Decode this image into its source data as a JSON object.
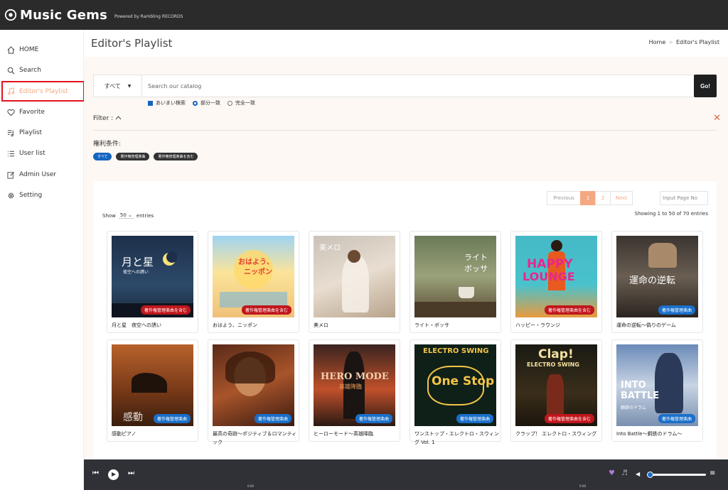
{
  "app": {
    "name": "Music Gems",
    "powered": "Powered by Rambling RECORDS"
  },
  "sidebar": {
    "items": [
      {
        "label": "HOME",
        "icon": "home-icon"
      },
      {
        "label": "Search",
        "icon": "search-icon"
      },
      {
        "label": "Editor's Playlist",
        "icon": "music-note-icon"
      },
      {
        "label": "Favorite",
        "icon": "heart-icon"
      },
      {
        "label": "Playlist",
        "icon": "playlist-icon"
      },
      {
        "label": "User list",
        "icon": "list-icon"
      },
      {
        "label": "Admin User",
        "icon": "edit-icon"
      },
      {
        "label": "Setting",
        "icon": "gear-icon"
      }
    ]
  },
  "page": {
    "title": "Editor's Playlist",
    "breadcrumb_home": "Home",
    "breadcrumb_current": "Editor's Playlist"
  },
  "search": {
    "select_value": "すべて",
    "placeholder": "Search our catalog",
    "go": "Go!",
    "opt_fuzzy": "あいまい検索",
    "opt_partial": "部分一致",
    "opt_exact": "完全一致"
  },
  "filter": {
    "label": "Filter :",
    "rights_label": "権利条件:",
    "tags": [
      "すべて",
      "著作権管理楽曲",
      "著作権管理楽曲を含む"
    ]
  },
  "table": {
    "prev": "Previous",
    "page1": "1",
    "page2": "2",
    "next": "Next",
    "page_input_placeholder": "Input Page No",
    "show": "Show",
    "show_value": "50",
    "entries": "entries",
    "showing": "Showing 1 to 50 of 70 entries"
  },
  "cards": [
    {
      "title": "月と星　夜空への誘い",
      "badge": "著作権管理楽曲を含む",
      "cover_text": "月と星",
      "cover_sub": "夜空への誘い"
    },
    {
      "title": "おはよう、ニッポン",
      "badge": "著作権管理楽曲を含む",
      "cover_text": "おはよう、",
      "cover_sub": "ニッポン"
    },
    {
      "title": "美メロ",
      "badge": "",
      "cover_text": "美メロ",
      "cover_sub": ""
    },
    {
      "title": "ライト・ボッサ",
      "badge": "",
      "cover_text": "ライト",
      "cover_sub": "ボッサ"
    },
    {
      "title": "ハッピー・ラウンジ",
      "badge": "著作権管理楽曲を含む",
      "cover_text": "HAPPY",
      "cover_sub": "LOUNGE"
    },
    {
      "title": "運命の逆転～偽りのゲーム",
      "badge": "著作権管理楽曲",
      "cover_text": "運命の逆転",
      "cover_sub": ""
    },
    {
      "title": "感動ピアノ",
      "badge": "著作権管理楽曲",
      "cover_text": "感動",
      "cover_sub": ""
    },
    {
      "title": "最高の奇跡～ポジティブ＆ロマンティック",
      "badge": "著作権管理楽曲",
      "cover_text": "",
      "cover_sub": ""
    },
    {
      "title": "ヒーローモード～英雄降臨",
      "badge": "著作権管理楽曲",
      "cover_text": "HERO MODE",
      "cover_sub": "英雄降臨"
    },
    {
      "title": "ワンストップ・エレクトロ・スウィング Vol. 1",
      "badge": "著作権管理楽曲",
      "cover_text": "One Stop",
      "cover_sub": "ELECTRO SWING"
    },
    {
      "title": "クラップ！ エレクトロ・スウィング",
      "badge": "著作権管理楽曲を含む",
      "cover_text": "Clap!",
      "cover_sub": "ELECTRO SWING"
    },
    {
      "title": "Into Battle～鋼鉄のドラム～",
      "badge": "著作権管理楽曲",
      "cover_text": "INTO BATTLE",
      "cover_sub": "鋼鉄のドラム"
    }
  ],
  "player": {
    "time_left": "0:00",
    "time_right": "0:00"
  },
  "colors": {
    "accent": "#f4a882",
    "dark": "#2b2b2b",
    "blue": "#1a6fc9",
    "red": "#c0161c"
  }
}
